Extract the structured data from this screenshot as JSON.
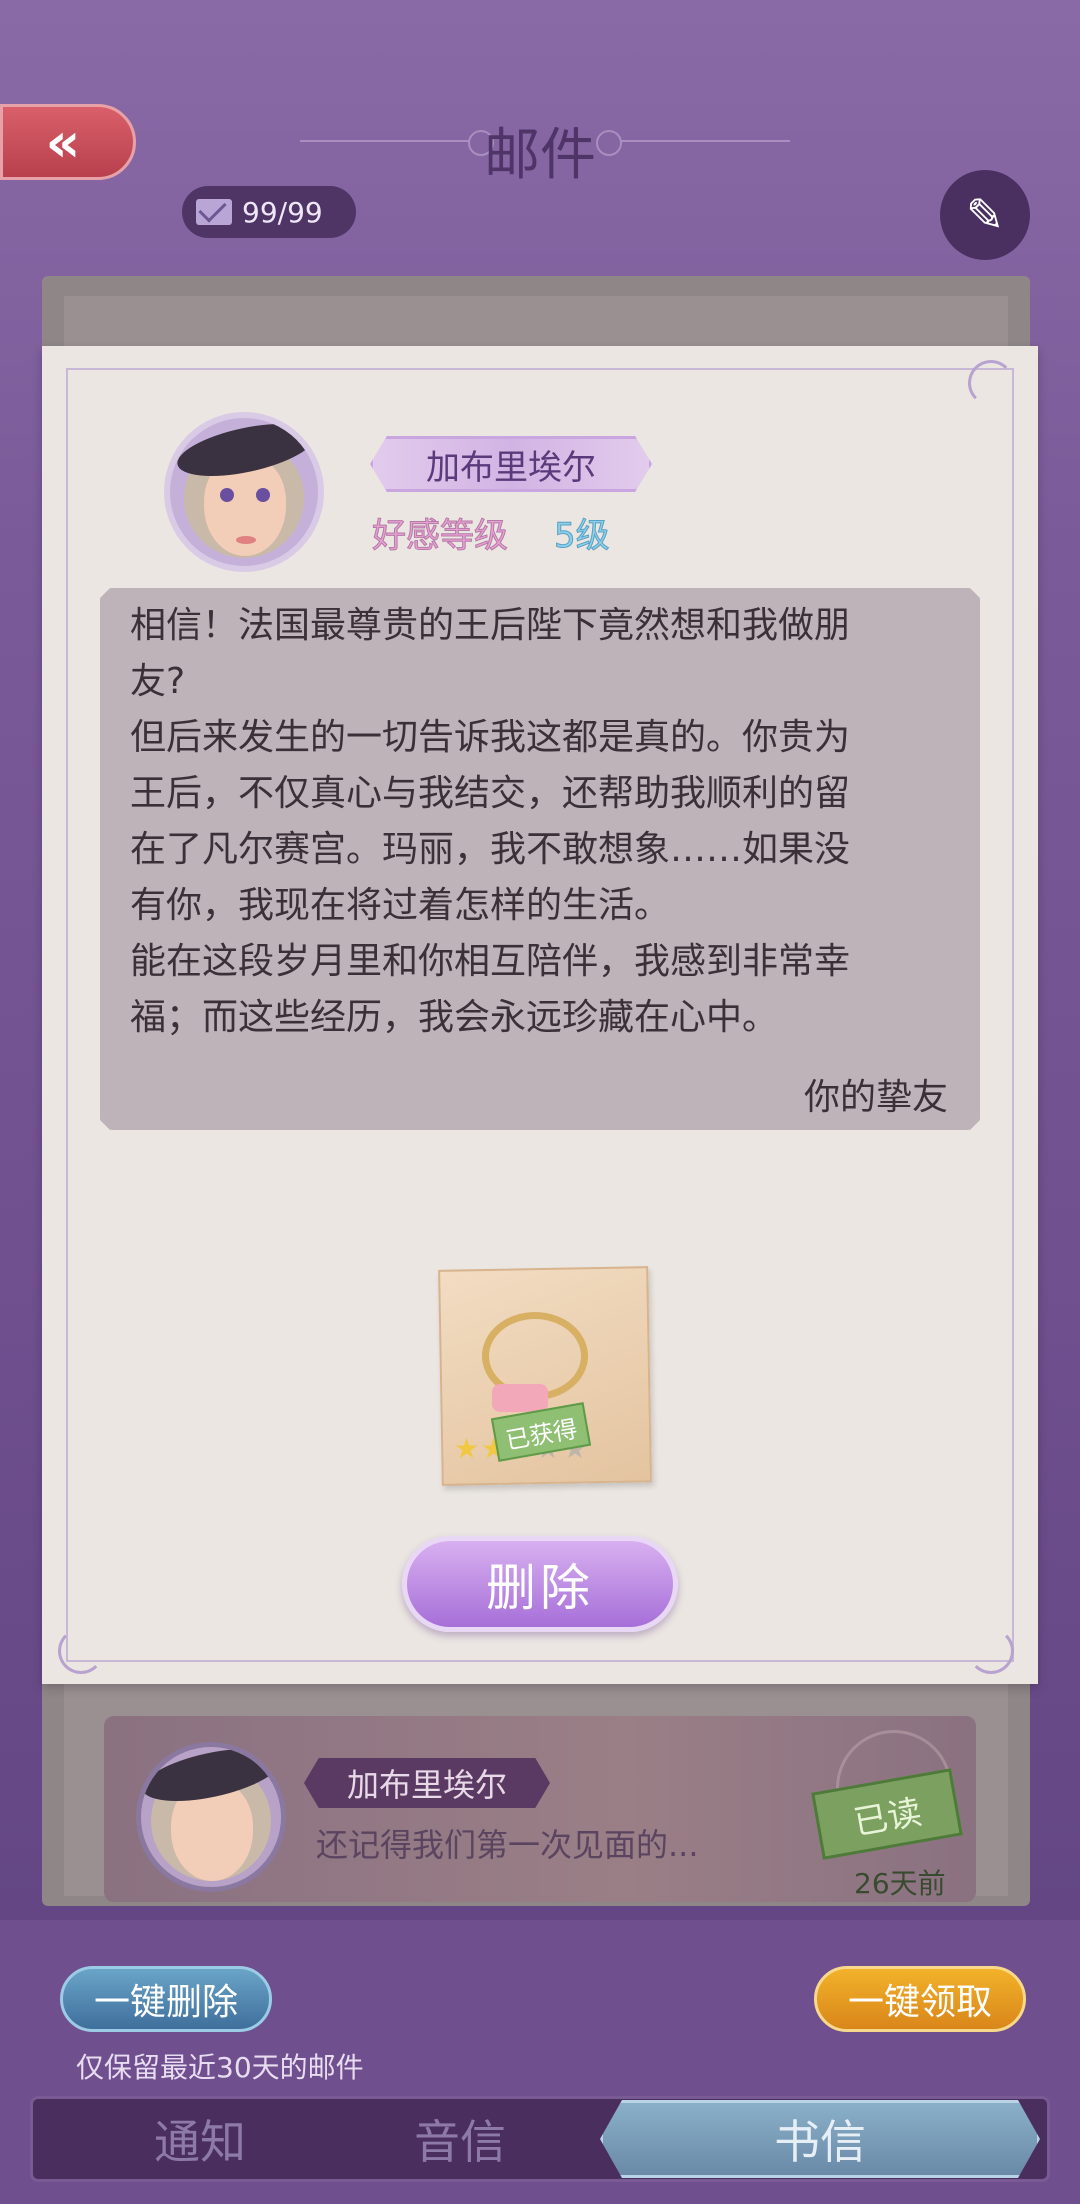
{
  "header": {
    "title": "邮件",
    "back_label": "«",
    "mail_count": "99/99",
    "edit_icon": "✎"
  },
  "letter": {
    "sender_name": "加布里埃尔",
    "affinity_label": "好感等级",
    "affinity_level": "5级",
    "body": "相信！法国最尊贵的王后陛下竟然想和我做朋\n友?\n但后来发生的一切告诉我这都是真的。你贵为\n王后，不仅真心与我结交，还帮助我顺利的留\n在了凡尔赛宫。玛丽，我不敢想象……如果没\n有你，我现在将过着怎样的生活。\n能在这段岁月里和你相互陪伴，我感到非常幸\n福；而这些经历，我会永远珍藏在心中。",
    "signature": "你的挚友",
    "reward": {
      "item_icon": "ring-icon",
      "stars_filled": 2,
      "stars_total": 5,
      "status": "已获得"
    },
    "delete_label": "删除"
  },
  "mail_list": [
    {
      "sender": "加布里埃尔",
      "preview": "还记得我们第一次见面的...",
      "status": "已读",
      "time": "26天前"
    }
  ],
  "footer": {
    "delete_all_label": "一键删除",
    "claim_all_label": "一键领取",
    "retention_note": "仅保留最近30天的邮件",
    "tabs": [
      {
        "label": "通知",
        "active": false
      },
      {
        "label": "音信",
        "active": false
      },
      {
        "label": "书信",
        "active": true
      }
    ]
  },
  "colors": {
    "background": "#7a5a98",
    "paper": "#ebe6e2",
    "accent_purple": "#a66fd8",
    "delete_all": "#3f6f9c",
    "claim_all": "#d9861a"
  }
}
